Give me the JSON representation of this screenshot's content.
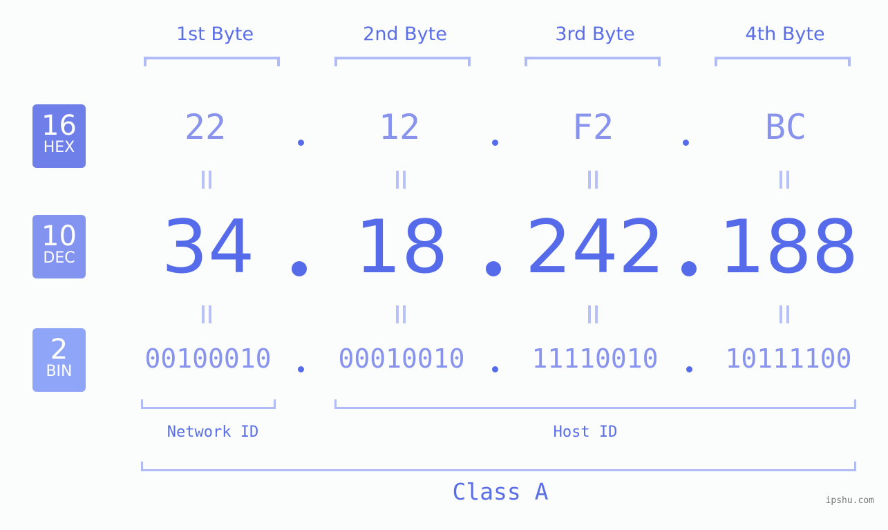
{
  "bytes": [
    {
      "label": "1st Byte",
      "hex": "22",
      "dec": "34",
      "bin": "00100010"
    },
    {
      "label": "2nd Byte",
      "hex": "12",
      "dec": "18",
      "bin": "00010010"
    },
    {
      "label": "3rd Byte",
      "hex": "F2",
      "dec": "242",
      "bin": "11110010"
    },
    {
      "label": "4th Byte",
      "hex": "BC",
      "dec": "188",
      "bin": "10111100"
    }
  ],
  "badges": {
    "hex": {
      "num": "16",
      "label": "HEX",
      "color": "#6e7fea"
    },
    "dec": {
      "num": "10",
      "label": "DEC",
      "color": "#8393f0"
    },
    "bin": {
      "num": "2",
      "label": "BIN",
      "color": "#8fa5f7"
    }
  },
  "network_id_label": "Network ID",
  "host_id_label": "Host ID",
  "class_label": "Class A",
  "watermark": "ipshu.com"
}
